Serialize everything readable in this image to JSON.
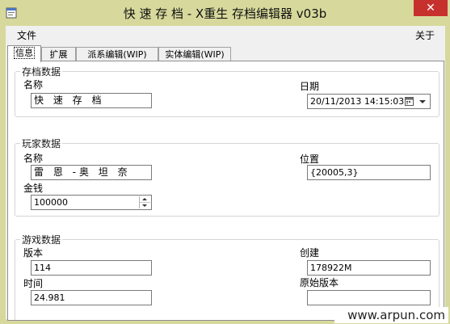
{
  "window": {
    "title": "快 速 存 档 - X重生 存档编辑器 v03b",
    "close_label": "✕"
  },
  "menu": {
    "file": "文件",
    "about": "关于"
  },
  "tabs": [
    {
      "label": "信息",
      "active": true
    },
    {
      "label": "扩展",
      "active": false
    },
    {
      "label": "派系编辑(WIP)",
      "active": false
    },
    {
      "label": "实体编辑(WIP)",
      "active": false
    }
  ],
  "save_group": {
    "title": "存档数据",
    "name_label": "名称",
    "name_value": "快 速 存 档",
    "date_label": "日期",
    "date_value": "20/11/2013 14:15:03"
  },
  "player_group": {
    "title": "玩家数据",
    "name_label": "名称",
    "name_value": "雷 恩 -奥 坦 奈",
    "location_label": "位置",
    "location_value": "{20005,3}",
    "money_label": "金钱",
    "money_value": "100000"
  },
  "game_group": {
    "title": "游戏数据",
    "version_label": "版本",
    "version_value": "114",
    "created_label": "创建",
    "created_value": "178922M",
    "time_label": "时间",
    "time_value": "24.981",
    "original_version_label": "原始版本",
    "original_version_value": ""
  },
  "watermark": "www.arpun.com",
  "colors": {
    "frame": "#d7d99c",
    "close": "#c7312d",
    "window_bg": "#f0f0f0"
  }
}
